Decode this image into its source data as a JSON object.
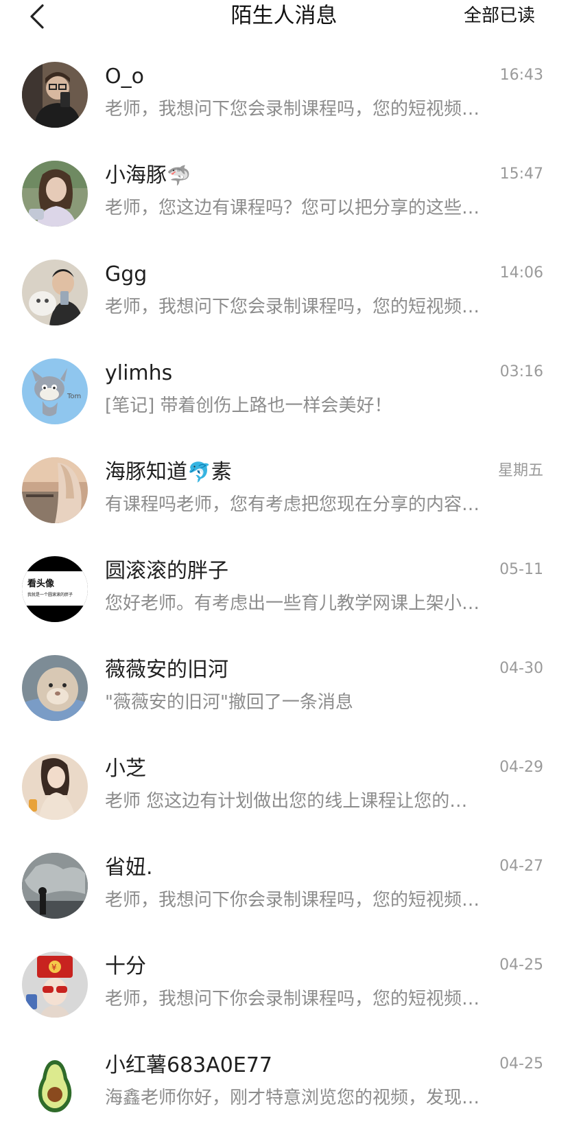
{
  "header": {
    "title": "陌生人消息",
    "mark_all_read": "全部已读"
  },
  "messages": [
    {
      "name": "O_o",
      "time": "16:43",
      "preview": "老师，我想问下您会录制课程吗，您的短视频…"
    },
    {
      "name": "小海豚",
      "emoji": "🦈",
      "time": "15:47",
      "preview": "老师，您这边有课程吗？您可以把分享的这些…"
    },
    {
      "name": "Ggg",
      "time": "14:06",
      "preview": "老师，我想问下您会录制课程吗，您的短视频…"
    },
    {
      "name": "ylimhs",
      "time": "03:16",
      "preview": "[笔记] 带着创伤上路也一样会美好！"
    },
    {
      "name": "海豚知道",
      "emoji": "🐬",
      "name_suffix": "素",
      "time": "星期五",
      "preview": "有课程吗老师，您有考虑把您现在分享的内容…"
    },
    {
      "name": "圆滚滚的胖子",
      "time": "05-11",
      "preview": "您好老师。有考虑出一些育儿教学网课上架小…",
      "avatar_text_1": "看头像",
      "avatar_text_2": "我就是一个圆滚滚的胖子"
    },
    {
      "name": "薇薇安的旧河",
      "time": "04-30",
      "preview": "\"薇薇安的旧河\"撤回了一条消息"
    },
    {
      "name": "小芝",
      "time": "04-29",
      "preview": "老师 您这边有计划做出您的线上课程让您的…"
    },
    {
      "name": "省妞.",
      "time": "04-27",
      "preview": "老师，我想问下你会录制课程吗，您的短视频…"
    },
    {
      "name": "十分",
      "time": "04-25",
      "preview": "老师，我想问下你会录制课程吗，您的短视频…"
    },
    {
      "name": "小红薯683A0E77",
      "time": "04-25",
      "preview": "海鑫老师你好，刚才特意浏览您的视频，发现…"
    }
  ]
}
